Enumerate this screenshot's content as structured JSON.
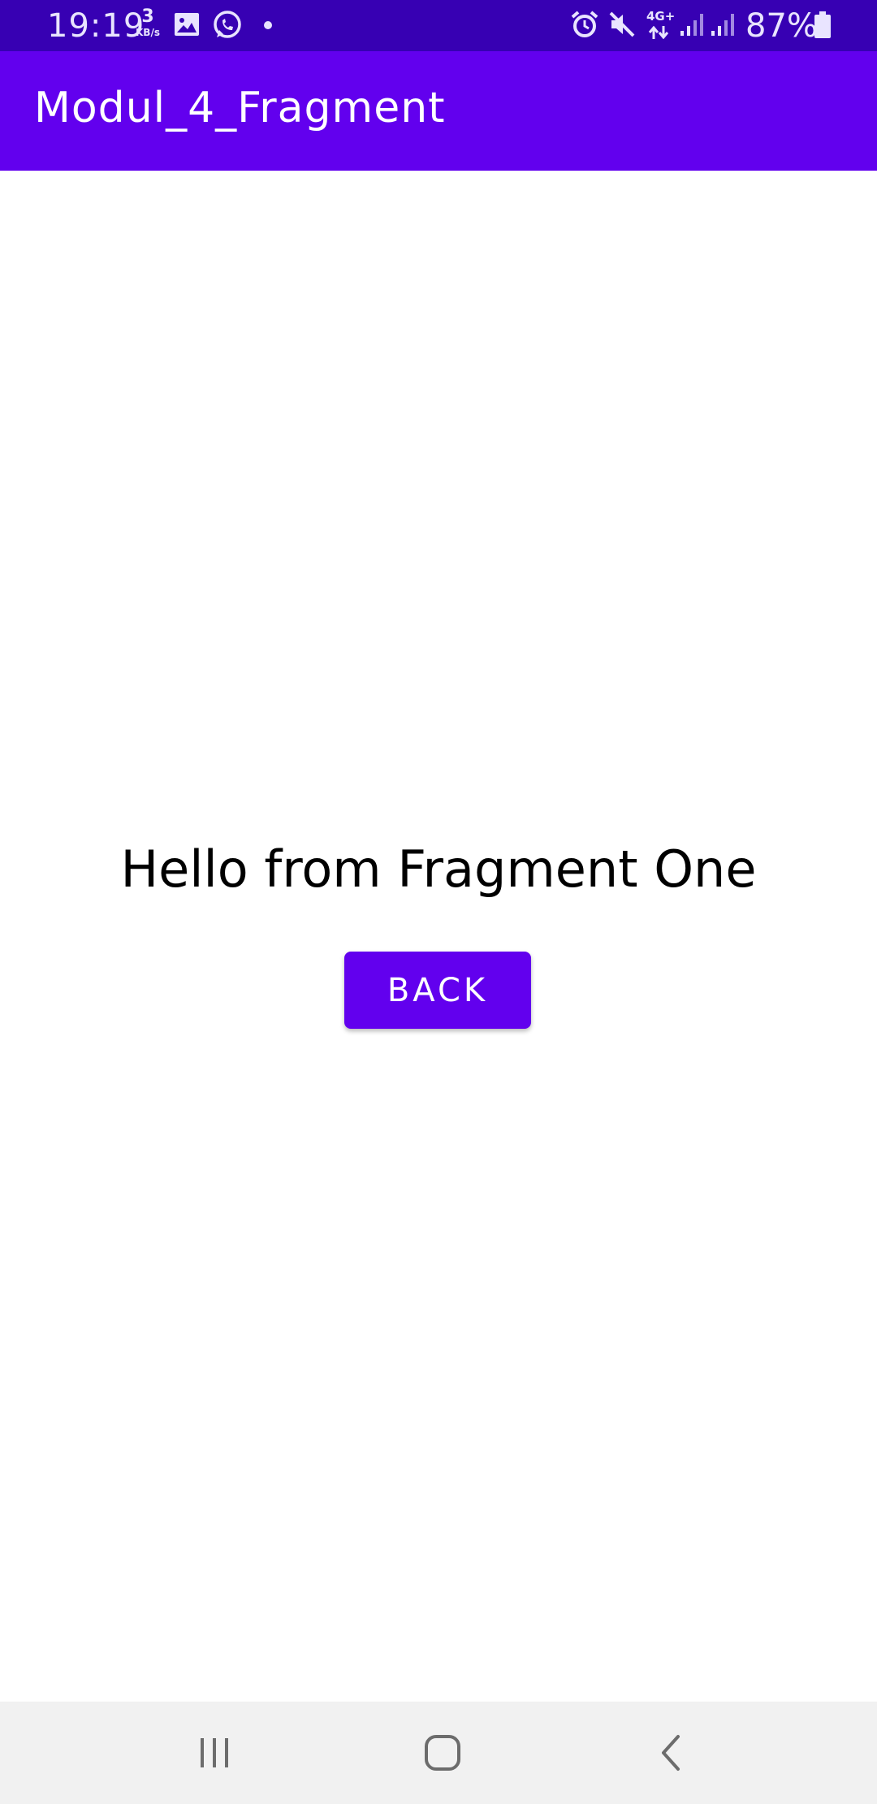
{
  "status_bar": {
    "time": "19:19",
    "speed_value": "3",
    "speed_unit": "KB/s",
    "network": "4G+",
    "battery": "87%",
    "icons": [
      "image-icon",
      "whatsapp-icon",
      "notification-dot",
      "alarm-icon",
      "mute-icon",
      "network-4g-icon",
      "signal-icon",
      "signal-icon",
      "battery-icon"
    ]
  },
  "app_bar": {
    "title": "Modul_4_Fragment",
    "color": "#6200ee"
  },
  "content": {
    "message": "Hello from Fragment One",
    "back_label": "BACK"
  },
  "nav_bar": {
    "icons": [
      "recent-apps-icon",
      "home-icon",
      "back-icon"
    ]
  },
  "colors": {
    "status_bar": "#3700b3",
    "primary": "#6200ee",
    "nav_bar": "#f1f1f1"
  }
}
